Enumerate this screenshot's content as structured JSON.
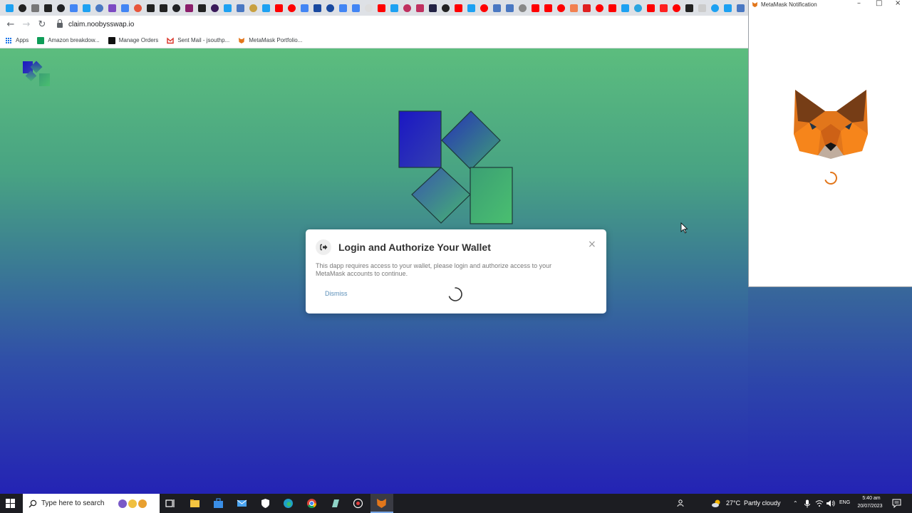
{
  "browser": {
    "tab_favicon_colors": [
      "#1da1f2",
      "#222222",
      "#777777",
      "#222222",
      "#202124",
      "#4285f4",
      "#1da1f2",
      "#4a78c2",
      "#7d4ac2",
      "#4285f4",
      "#e8553a",
      "#222222",
      "#222222",
      "#202124",
      "#8b1e6b",
      "#222222",
      "#3a1a5a",
      "#1da1f2",
      "#4a78c2",
      "#c8a040",
      "#1da1f2",
      "#ff0000",
      "#ff0000",
      "#4285f4",
      "#1a4aa0",
      "#1a4aa0",
      "#4285f4",
      "#4285f4",
      "#dddddd",
      "#ff0000",
      "#1da1f2",
      "#c03060",
      "#c03060",
      "#222244",
      "#222222",
      "#ff0000",
      "#1da1f2",
      "#ff0000",
      "#4a78c2",
      "#4a78c2",
      "#888888",
      "#ff0000",
      "#ff0000",
      "#ff0000",
      "#f28050",
      "#e02020",
      "#ff0000",
      "#ff0000",
      "#1da1f2",
      "#2aa5e0",
      "#ff0000",
      "#ff2020",
      "#ff0000",
      "#222222",
      "#cccccc",
      "#1da1f2",
      "#1da1f2",
      "#4a78c2",
      "#1da1f2"
    ],
    "url": "claim.noobysswap.io",
    "bookmarks": {
      "apps": "Apps",
      "items": [
        "Amazon breakdow...",
        "Manage Orders",
        "Sent Mail - jsouthp...",
        "MetaMask Portfolio..."
      ]
    }
  },
  "modal": {
    "title": "Login and Authorize Your Wallet",
    "body": "This dapp requires access to your wallet, please login and authorize access to your MetaMask accounts to continue.",
    "dismiss_label": "Dismiss"
  },
  "metamask": {
    "window_title": "MetaMask Notification"
  },
  "taskbar": {
    "search_placeholder": "Type here to search",
    "weather_temp": "27°C",
    "weather_desc": "Partly cloudy",
    "language": "ENG",
    "time": "5:40 am",
    "date": "20/07/2023"
  },
  "colors": {
    "page_gradient_top": "#5cbd7e",
    "page_gradient_bottom": "#2423b4",
    "logo_blue": "#1e1eb8",
    "logo_green": "#3ab06a",
    "metamask_orange": "#e2761b",
    "link_blue": "#5b8fb9"
  }
}
